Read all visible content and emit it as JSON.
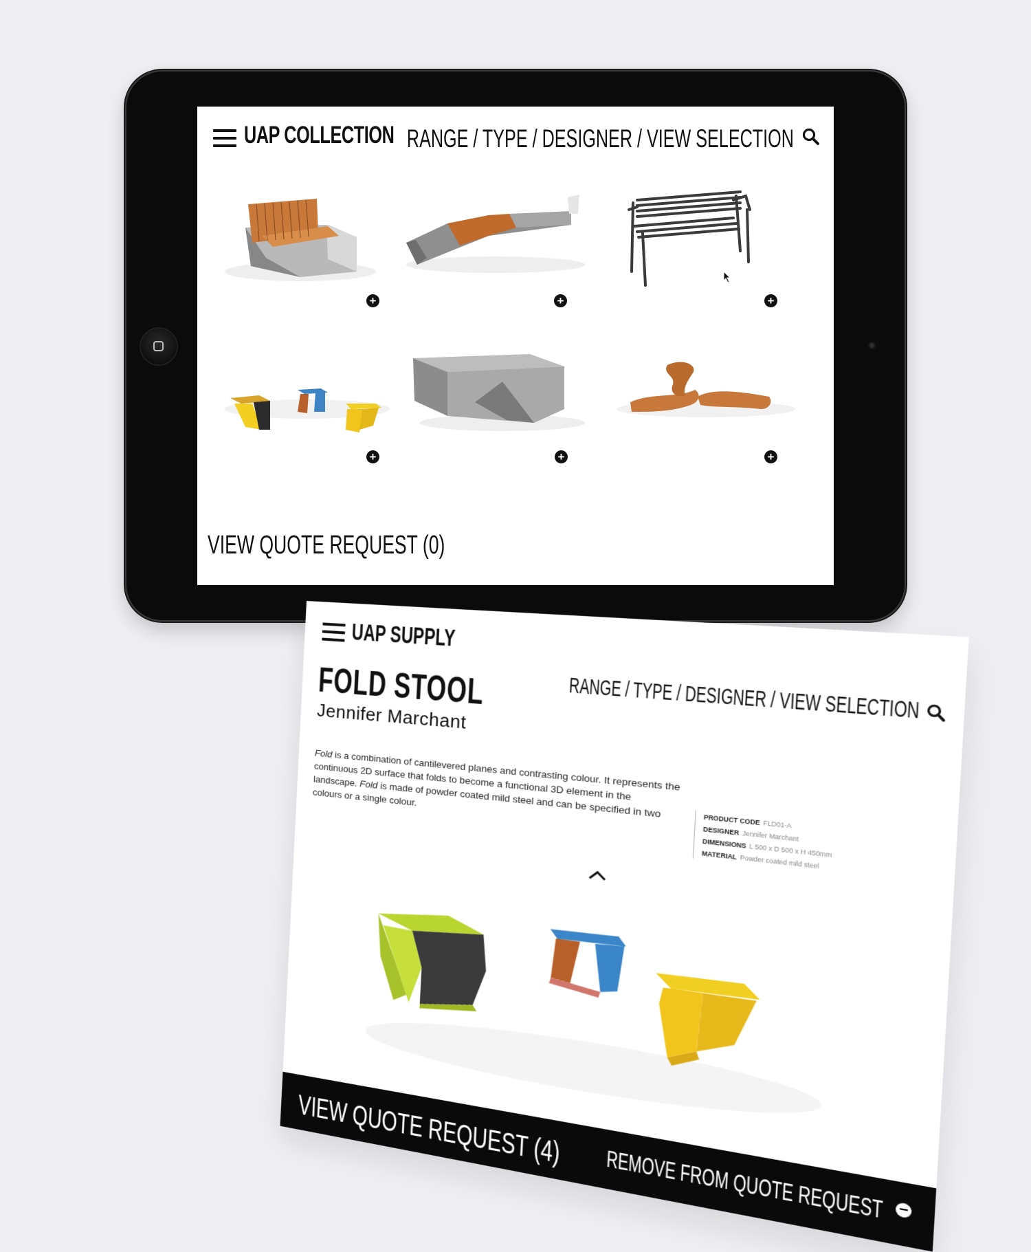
{
  "tablet": {
    "logo": "UAP COLLECTION",
    "nav": "RANGE / TYPE / DESIGNER / VIEW SELECTION",
    "quote_link": "VIEW QUOTE REQUEST (0)",
    "products": [
      {
        "icon": "timber-concrete-bench",
        "add_label": "+"
      },
      {
        "icon": "concrete-timber-linear-bench",
        "add_label": "+"
      },
      {
        "icon": "steel-slat-bench",
        "add_label": "+"
      },
      {
        "icon": "fold-stools",
        "add_label": "+"
      },
      {
        "icon": "granite-block-bench",
        "add_label": "+"
      },
      {
        "icon": "curved-timber-benches",
        "add_label": "+"
      }
    ]
  },
  "detail": {
    "logo": "UAP SUPPLY",
    "nav": "RANGE / TYPE / DESIGNER / VIEW SELECTION",
    "title": "FOLD STOOL",
    "designer": "Jennifer Marchant",
    "description_parts": {
      "p1_em": "Fold",
      "p1": " is a combination of cantilevered planes and contrasting colour. It represents the continuous 2D surface that folds to become a functional 3D element in the landscape. ",
      "p2_em": "Fold",
      "p2": " is made of powder coated mild steel and can be specified in two colours or a single colour."
    },
    "specs": [
      {
        "label": "PRODUCT CODE",
        "value": "FLD01-A"
      },
      {
        "label": "DESIGNER",
        "value": "Jennifer Marchant"
      },
      {
        "label": "DIMENSIONS",
        "value": "L 500 x D 500 x H 450mm"
      },
      {
        "label": "MATERIAL",
        "value": "Powder coated mild steel"
      }
    ],
    "quote_link": "VIEW QUOTE REQUEST (4)",
    "remove_label": "REMOVE FROM QUOTE REQUEST",
    "remove_icon": "−"
  },
  "colors": {
    "accent_lime": "#b9d630",
    "accent_blue": "#3b86c8",
    "accent_orange": "#b8602a",
    "accent_yellow": "#f1cf22",
    "timber": "#c7783a",
    "concrete": "#9c9c9c",
    "footer": "#0a0a0a"
  }
}
